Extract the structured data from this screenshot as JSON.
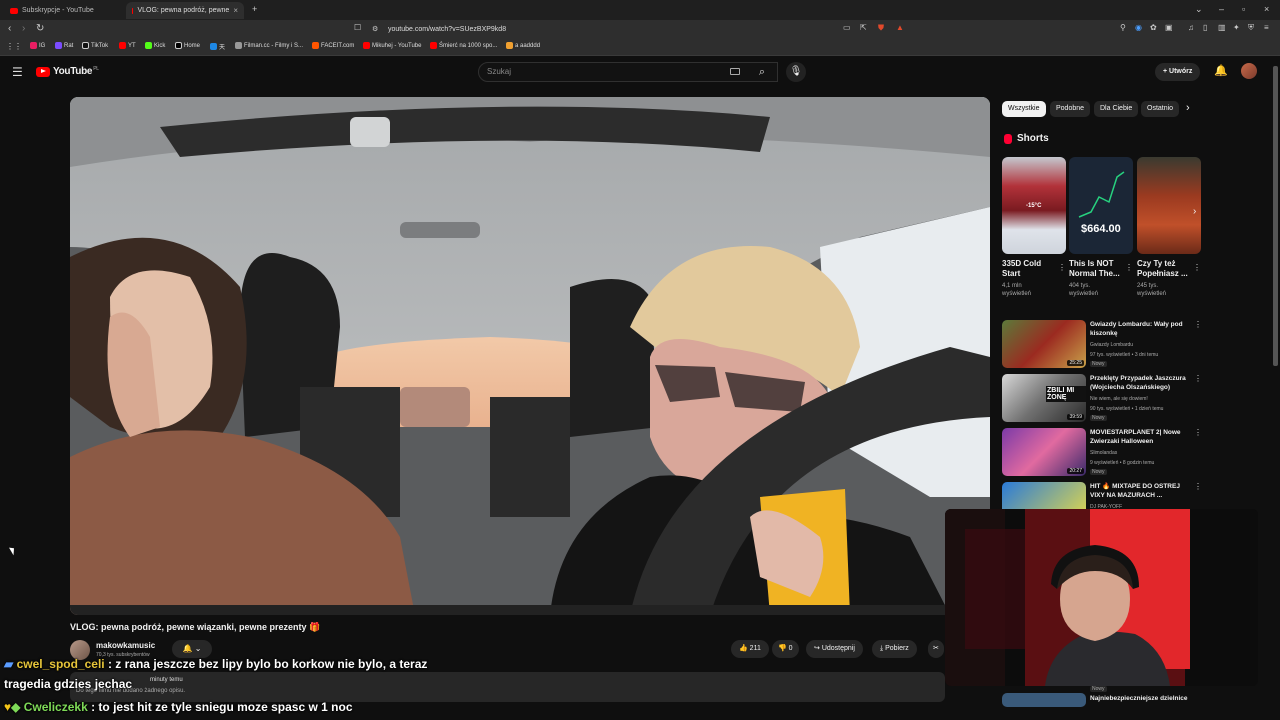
{
  "browser": {
    "tabs": [
      {
        "title": "Subskrypcje - YouTube",
        "active": false
      },
      {
        "title": "VLOG: pewna podróż, pewne",
        "active": true
      }
    ],
    "url": "youtube.com/watch?v=SUezBXP9kd8",
    "bookmarks": [
      "IG",
      "Rat",
      "TikTok",
      "YT",
      "Kick",
      "Home",
      "天",
      "Filman.cc - Filmy i S...",
      "FACEIT.com",
      "Mikuhej - YouTube",
      "Śmierć na 1000 spo...",
      "a aadddd"
    ]
  },
  "youtube": {
    "logo": "YouTube",
    "region": "PL",
    "search_placeholder": "Szukaj",
    "create_label": "Utwórz"
  },
  "video": {
    "title": "VLOG: pewna podróż, pewne wiązanki, pewne prezenty 🎁",
    "channel": "makowkamusic",
    "subscribers": "70,3 tys. subskrybentów",
    "likes": "211",
    "dislikes": "0",
    "share_label": "Udostępnij",
    "download_label": "Pobierz",
    "desc_line1": "minuty temu",
    "desc_line2": "Do tego filmu nie dodano żadnego opisu."
  },
  "sidebar": {
    "chips": [
      "Wszystkie",
      "Podobne",
      "Dla Ciebie",
      "Ostatnio"
    ],
    "shorts_header": "Shorts",
    "shorts": [
      {
        "title": "335D Cold Start",
        "views": "4,1 mln wyświetleń",
        "overlay": "-15°C"
      },
      {
        "title": "This Is NOT Normal The...",
        "views": "404 tys. wyświetleń",
        "overlay": "$664.00"
      },
      {
        "title": "Czy Ty też Popełniasz ...",
        "views": "245 tys. wyświetleń",
        "overlay": ""
      }
    ],
    "recommended": [
      {
        "title": "Gwiazdy Lombardu: Wały pod kiszonkę",
        "channel": "Gwiazdy Lombardu",
        "meta": "97 tys. wyświetleń • 3 dni temu",
        "badge": "Nowy",
        "duration": "25:25"
      },
      {
        "title": "Przeklęty Przypadek Jaszczura (Wojciecha Olszańskiego)",
        "channel": "Nie wiem, ale się dowiem!",
        "meta": "90 tys. wyświetleń • 1 dzień temu",
        "badge": "Nowy",
        "duration": "39:59",
        "overlay": "ZBILI MI ŻONĘ"
      },
      {
        "title": "MOVIESTARPLANET 2| Nowe Zwierzaki Halloween",
        "channel": "Slimolandas",
        "meta": "9 wyświetleń • 8 godzin temu",
        "badge": "Nowy",
        "duration": "20:27"
      },
      {
        "title": "HIT 🔥 MIXTAPE DO OSTREJ VIXY NA MAZURACH ...",
        "channel": "DJ PAK-YOFF",
        "meta": "",
        "badge": "",
        "duration": ""
      },
      {
        "title": "Najniebezpieczniejsze dzielnice",
        "channel": "",
        "meta": "",
        "badge": "Nowy",
        "duration": ""
      }
    ]
  },
  "chat": [
    {
      "user": "cwel_spod_celi",
      "message": ": z rana jeszcze bez lipy bylo bo korkow nie bylo, a teraz",
      "user_color": "#e6c53a"
    },
    {
      "user": "",
      "message": "tragedia gdzies jechac",
      "user_color": "#ffffff"
    },
    {
      "user": "Cweliczekk",
      "message": ": to jest hit ze tyle sniegu moze spasc w 1 noc",
      "user_color": "#7ed957"
    }
  ],
  "colors": {
    "accent": "#ff0000",
    "bg": "#0f0f0f",
    "chip_bg": "#272727"
  }
}
